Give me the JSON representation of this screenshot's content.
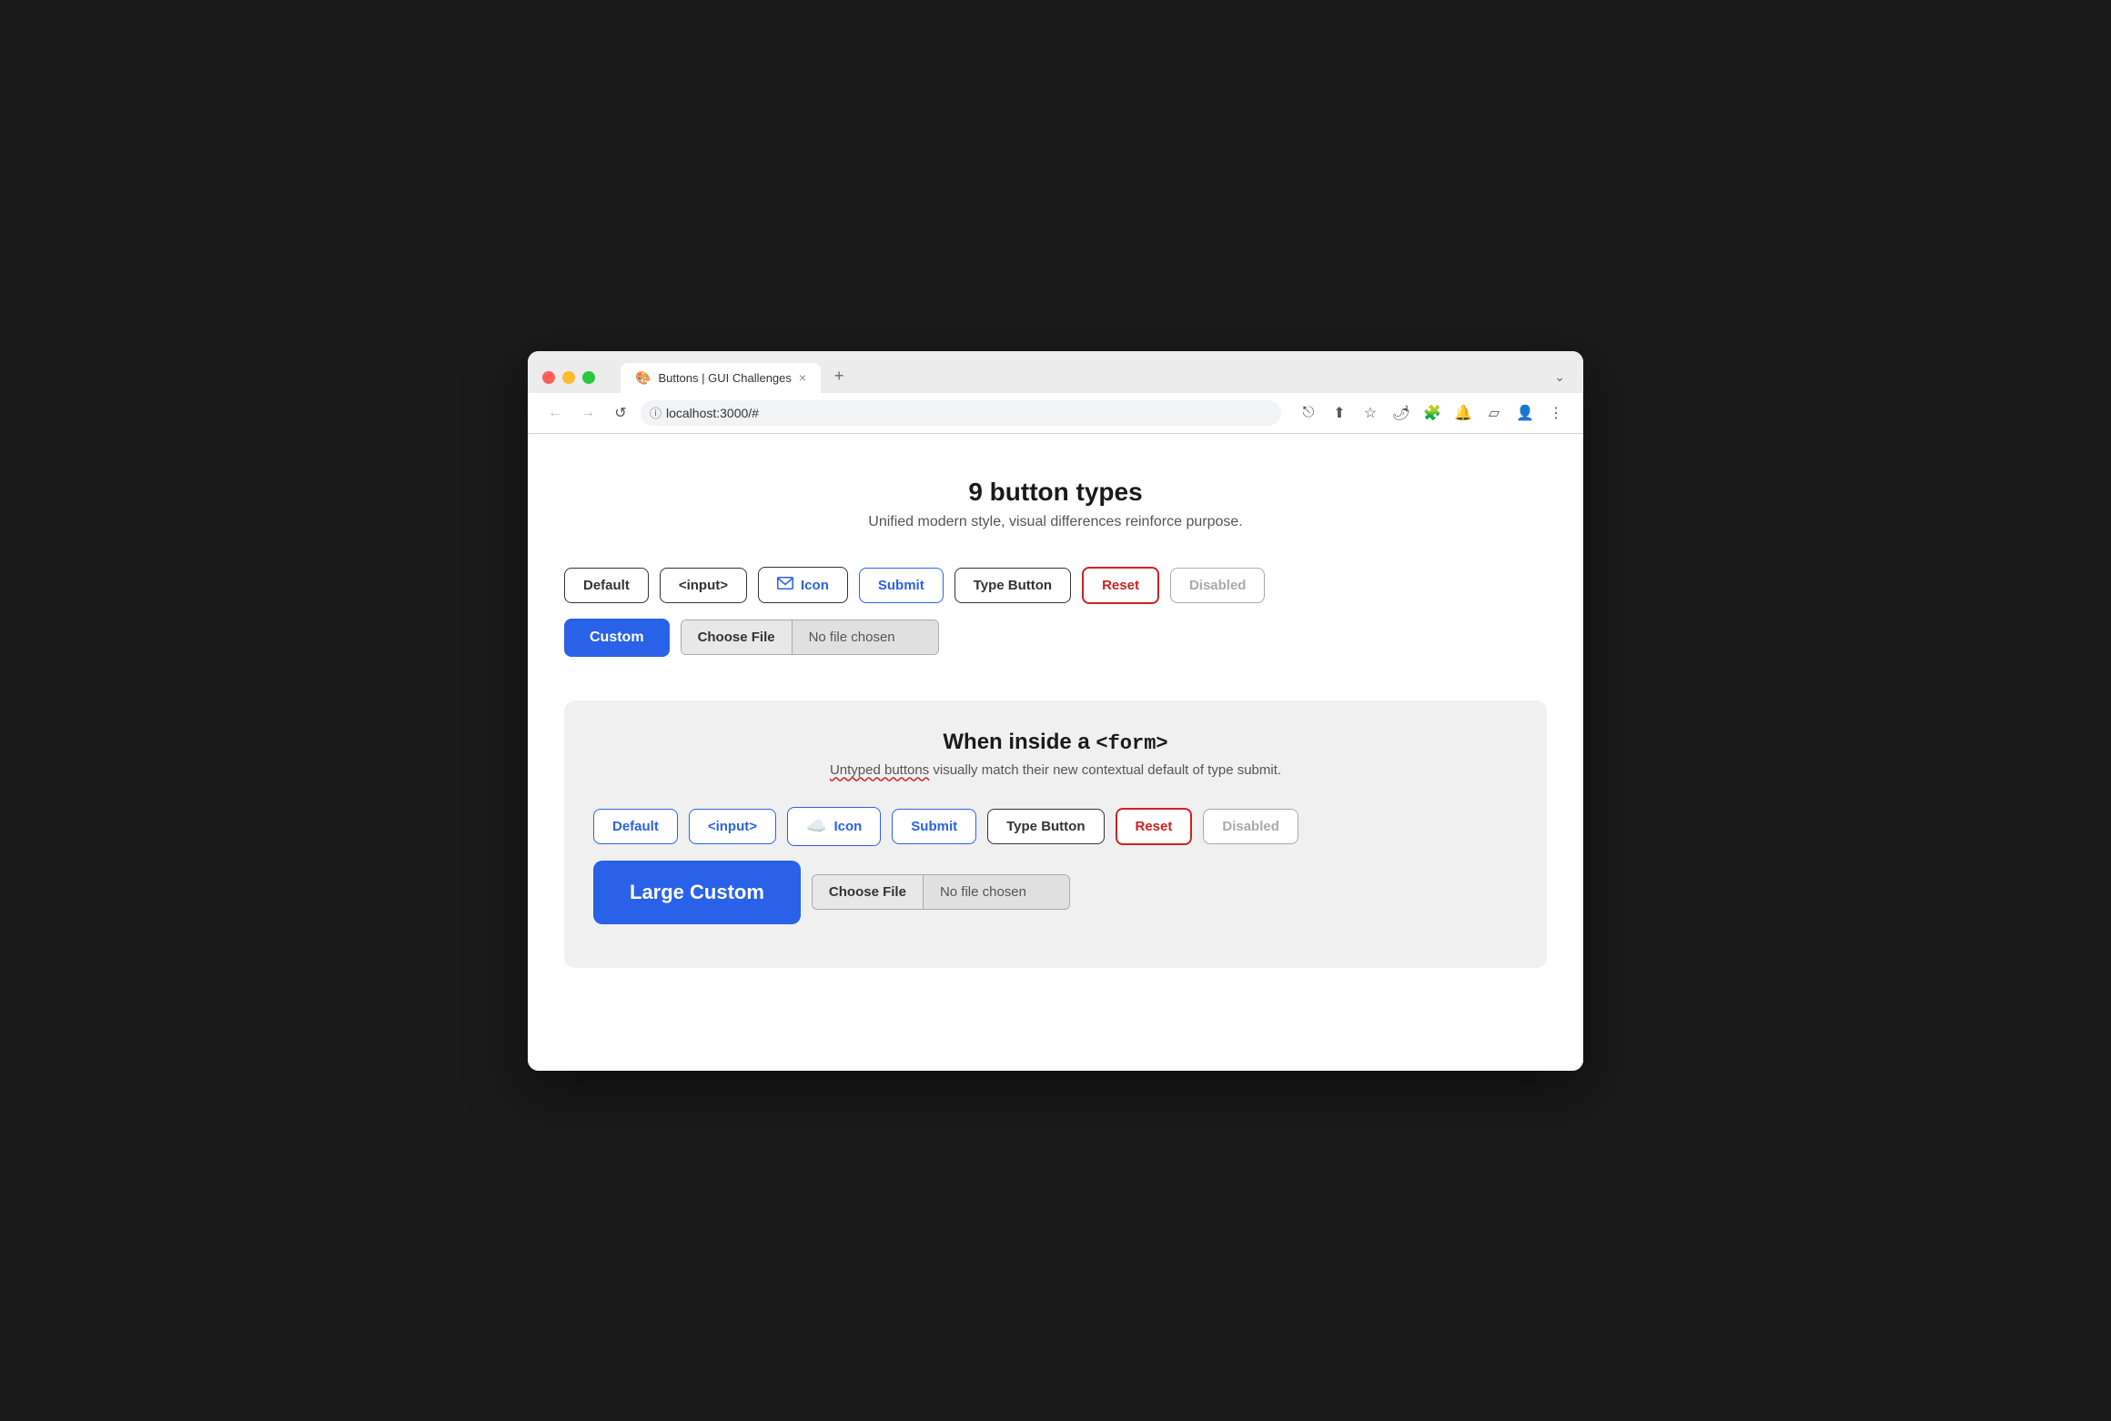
{
  "browser": {
    "tab_title": "Buttons | GUI Challenges",
    "url": "localhost:3000/#",
    "tab_icon": "🎨",
    "close_label": "×",
    "new_tab_label": "+",
    "chevron_label": "⌄"
  },
  "nav": {
    "back_icon": "←",
    "forward_icon": "→",
    "reload_icon": "↺",
    "security_icon": "ⓘ",
    "external_icon": "⎋",
    "share_icon": "⬆",
    "bookmark_icon": "☆",
    "extension1_icon": "🌶",
    "extension2_icon": "🧩",
    "extension3_icon": "🔔",
    "sidebar_icon": "▱",
    "profile_icon": "👤",
    "menu_icon": "⋮"
  },
  "page": {
    "title": "9 button types",
    "subtitle": "Unified modern style, visual differences reinforce purpose."
  },
  "top_section": {
    "buttons": {
      "default": "Default",
      "input": "<input>",
      "icon_label": "Icon",
      "submit": "Submit",
      "type_button": "Type Button",
      "reset": "Reset",
      "disabled": "Disabled",
      "custom": "Custom",
      "choose_file": "Choose File",
      "no_file_chosen": "No file chosen"
    }
  },
  "form_section": {
    "title": "When inside a",
    "title_code": "<form>",
    "subtitle_plain": " visually match their new contextual default of type submit.",
    "subtitle_underlined": "Untyped buttons",
    "buttons": {
      "default": "Default",
      "input": "<input>",
      "icon_label": "Icon",
      "submit": "Submit",
      "type_button": "Type Button",
      "reset": "Reset",
      "disabled": "Disabled",
      "large_custom": "Large Custom",
      "choose_file": "Choose File",
      "no_file_chosen": "No file chosen"
    }
  }
}
